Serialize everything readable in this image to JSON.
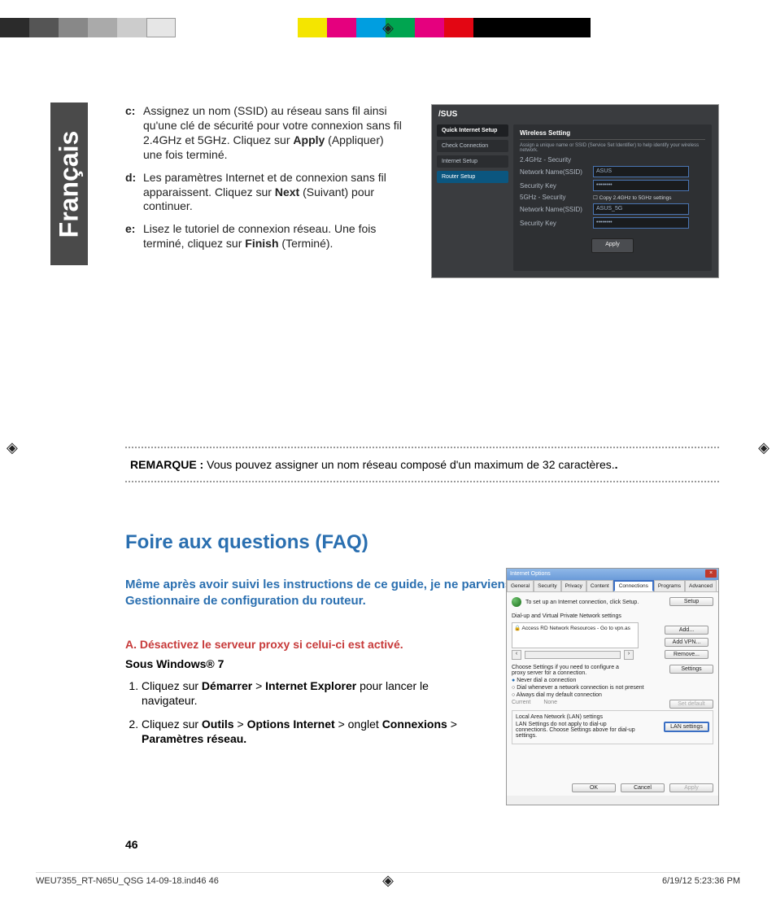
{
  "meta": {
    "language_tab": "Français",
    "page_number": "46",
    "footer_file": "WEU7355_RT-N65U_QSG 14-09-18.ind46   46",
    "footer_date": "6/19/12   5:23:36 PM"
  },
  "steps": {
    "c": {
      "label": "c:",
      "before": "Assignez un nom (SSID) au réseau sans fil ainsi qu'une clé de sécurité pour votre connexion sans fil 2.4GHz et 5GHz. Cliquez sur ",
      "bold": "Apply",
      "after": " (Appliquer) une fois terminé."
    },
    "d": {
      "label": "d:",
      "before": "Les paramètres Internet et de connexion sans fil apparaissent. Cliquez sur ",
      "bold": "Next",
      "after": " (Suivant) pour continuer."
    },
    "e": {
      "label": "e:",
      "before": "Lisez le tutoriel de connexion réseau. Une fois terminé, cliquez sur ",
      "bold": "Finish",
      "after": " (Terminé)."
    }
  },
  "note": {
    "label": "REMARQUE :",
    "text": " Vous pouvez assigner un nom réseau composé d'un maximum de 32 caractères."
  },
  "asus": {
    "logo": "/SUS",
    "sidebar": {
      "header": "Quick Internet Setup",
      "items": [
        "Check Connection",
        "Internet Setup",
        "Router Setup"
      ],
      "selected_index": 2
    },
    "panel_title": "Wireless Setting",
    "panel_hint": "Assign a unique name or SSID (Service Set Identifier) to help identify your wireless network.",
    "rows": [
      {
        "k": "2.4GHz - Security",
        "v": ""
      },
      {
        "k": "Network Name(SSID)",
        "v": "ASUS"
      },
      {
        "k": "Security Key",
        "v": "••••••••"
      },
      {
        "k": "5GHz - Security",
        "v": "Copy 2.4GHz to 5GHz settings",
        "checkbox": true
      },
      {
        "k": "Network Name(SSID)",
        "v": "ASUS_5G"
      },
      {
        "k": "Security Key",
        "v": "••••••••"
      }
    ],
    "apply": "Apply"
  },
  "faq": {
    "title": "Foire aux questions (FAQ)",
    "question": "Même après avoir suivi les instructions de ce guide, je ne parviens toujours pas à accéder au Gestionnaire de configuration du routeur.",
    "a_label": "A.   Désactivez le serveur proxy si celui-ci est activé.",
    "os": "Sous Windows® 7",
    "steps": [
      {
        "pre": "Cliquez sur ",
        "b1": "Démarrer",
        "mid1": " > ",
        "b2": "Internet Explorer",
        "post": " pour lancer le navigateur."
      },
      {
        "pre": "Cliquez sur ",
        "b1": "Outils",
        "mid1": " > ",
        "b2": "Options Internet",
        "mid2": " > onglet ",
        "b3": "Connexions",
        "mid3": " > ",
        "b4": "Paramètres réseau."
      }
    ]
  },
  "ie": {
    "title": "Internet Options",
    "tabs": [
      "General",
      "Security",
      "Privacy",
      "Content",
      "Connections",
      "Programs",
      "Advanced"
    ],
    "active_tab": 4,
    "setup_text": "To set up an Internet connection, click Setup.",
    "setup_btn": "Setup",
    "dialup_label": "Dial-up and Virtual Private Network settings",
    "list_item": "Access RD Network Resources - Go to vpn.as",
    "btns": {
      "add": "Add...",
      "addvpn": "Add VPN...",
      "remove": "Remove..."
    },
    "choose_text": "Choose Settings if you need to configure a proxy server for a connection.",
    "settings_btn": "Settings",
    "radios": [
      "Never dial a connection",
      "Dial whenever a network connection is not present",
      "Always dial my default connection"
    ],
    "radio_selected": 0,
    "current": "Current",
    "none": "None",
    "setdefault": "Set default",
    "lan_label": "Local Area Network (LAN) settings",
    "lan_text": "LAN Settings do not apply to dial-up connections. Choose Settings above for dial-up settings.",
    "lan_btn": "LAN settings",
    "ok": "OK",
    "cancel": "Cancel",
    "applybtn": "Apply"
  }
}
